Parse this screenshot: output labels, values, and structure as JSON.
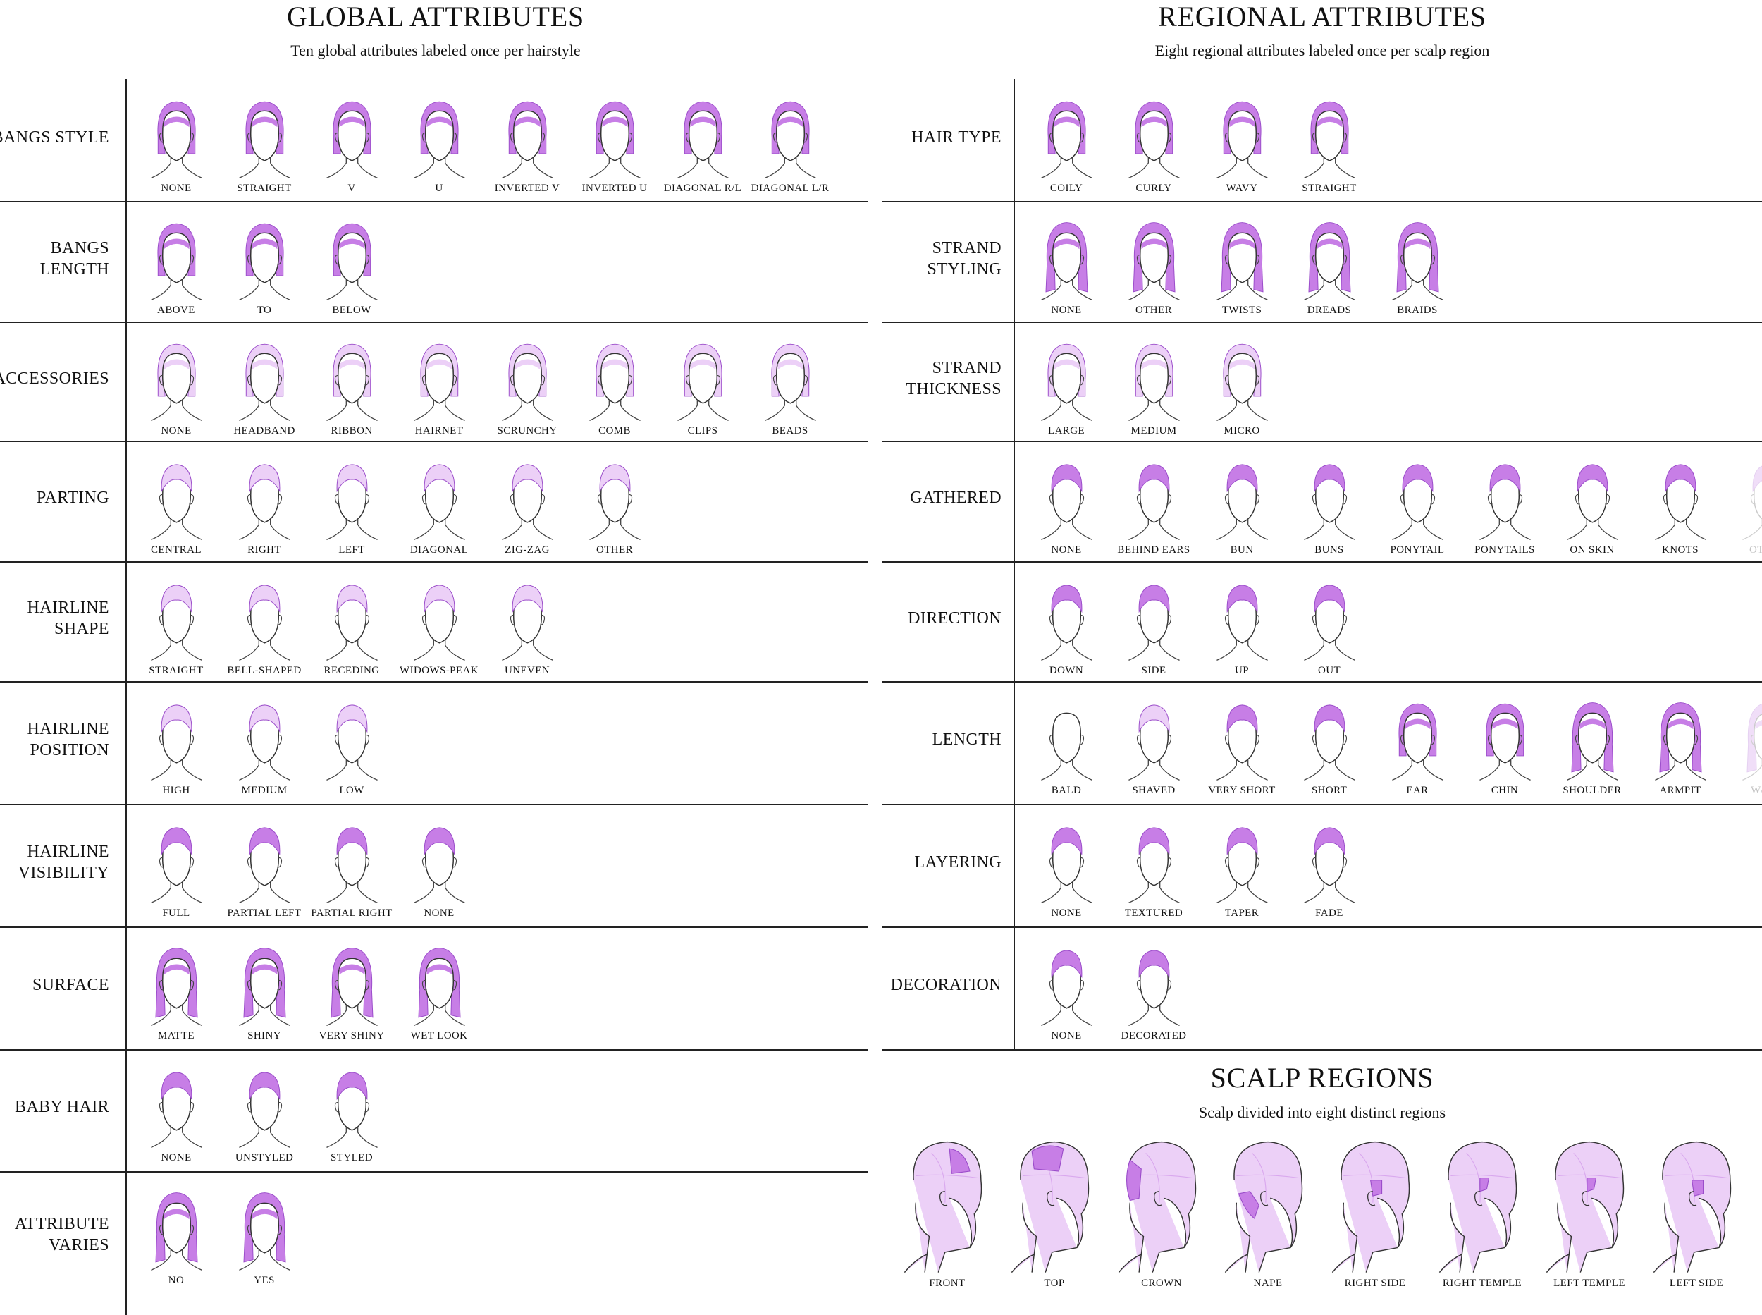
{
  "global": {
    "title": "GLOBAL ATTRIBUTES",
    "subtitle": "Ten global attributes labeled once per hairstyle",
    "rows": [
      {
        "label": "BANGS STYLE",
        "items": [
          "NONE",
          "STRAIGHT",
          "V",
          "U",
          "INVERTED V",
          "INVERTED U",
          "DIAGONAL R/L",
          "DIAGONAL L/R"
        ]
      },
      {
        "label": "BANGS\nLENGTH",
        "items": [
          "ABOVE",
          "TO",
          "BELOW"
        ]
      },
      {
        "label": "ACCESSORIES",
        "items": [
          "NONE",
          "HEADBAND",
          "RIBBON",
          "HAIRNET",
          "SCRUNCHY",
          "COMB",
          "CLIPS",
          "BEADS"
        ]
      },
      {
        "label": "PARTING",
        "items": [
          "CENTRAL",
          "RIGHT",
          "LEFT",
          "DIAGONAL",
          "ZIG-ZAG",
          "OTHER"
        ]
      },
      {
        "label": "HAIRLINE\nSHAPE",
        "items": [
          "STRAIGHT",
          "BELL-SHAPED",
          "RECEDING",
          "WIDOWS-PEAK",
          "UNEVEN"
        ]
      },
      {
        "label": "HAIRLINE\nPOSITION",
        "items": [
          "HIGH",
          "MEDIUM",
          "LOW"
        ]
      },
      {
        "label": "HAIRLINE\nVISIBILITY",
        "items": [
          "FULL",
          "PARTIAL LEFT",
          "PARTIAL RIGHT",
          "NONE"
        ]
      },
      {
        "label": "SURFACE",
        "items": [
          "MATTE",
          "SHINY",
          "VERY SHINY",
          "WET LOOK"
        ]
      },
      {
        "label": "BABY HAIR",
        "items": [
          "NONE",
          "UNSTYLED",
          "STYLED"
        ]
      },
      {
        "label": "ATTRIBUTE\nVARIES",
        "items": [
          "NO",
          "YES"
        ]
      }
    ]
  },
  "regional": {
    "title": "REGIONAL ATTRIBUTES",
    "subtitle": "Eight regional attributes labeled once per scalp region",
    "rows": [
      {
        "label": "HAIR TYPE",
        "items": [
          "COILY",
          "CURLY",
          "WAVY",
          "STRAIGHT"
        ]
      },
      {
        "label": "STRAND\nSTYLING",
        "items": [
          "NONE",
          "OTHER",
          "TWISTS",
          "DREADS",
          "BRAIDS"
        ]
      },
      {
        "label": "STRAND\nTHICKNESS",
        "items": [
          "LARGE",
          "MEDIUM",
          "MICRO"
        ]
      },
      {
        "label": "GATHERED",
        "items": [
          "NONE",
          "BEHIND EARS",
          "BUN",
          "BUNS",
          "PONYTAIL",
          "PONYTAILS",
          "ON SKIN",
          "KNOTS",
          "OTHER"
        ],
        "faded_last": true
      },
      {
        "label": "DIRECTION",
        "items": [
          "DOWN",
          "SIDE",
          "UP",
          "OUT"
        ]
      },
      {
        "label": "LENGTH",
        "items": [
          "BALD",
          "SHAVED",
          "VERY SHORT",
          "SHORT",
          "EAR",
          "CHIN",
          "SHOULDER",
          "ARMPIT",
          "WAIST"
        ],
        "faded_last": true
      },
      {
        "label": "LAYERING",
        "items": [
          "NONE",
          "TEXTURED",
          "TAPER",
          "FADE"
        ]
      },
      {
        "label": "DECORATION",
        "items": [
          "NONE",
          "DECORATED"
        ]
      }
    ]
  },
  "scalp": {
    "title": "SCALP REGIONS",
    "subtitle": "Scalp divided into eight distinct regions",
    "regions": [
      "FRONT",
      "TOP",
      "CROWN",
      "NAPE",
      "RIGHT SIDE",
      "RIGHT TEMPLE",
      "LEFT TEMPLE",
      "LEFT SIDE"
    ]
  },
  "colors": {
    "hair": "#c77ee6",
    "hair_stroke": "#9b4dca",
    "hair_light": "#ecd0f7",
    "line": "#222222"
  }
}
